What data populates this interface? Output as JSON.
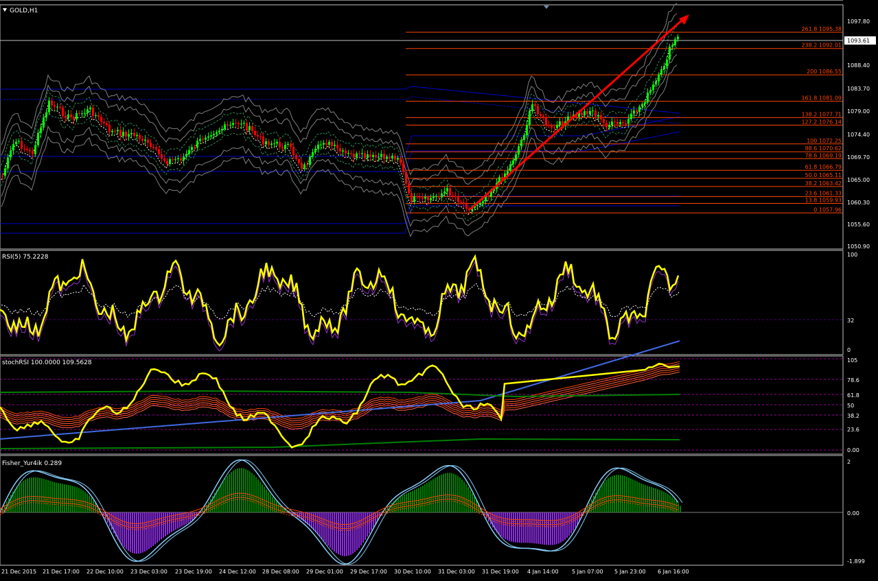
{
  "symbol_title": "GOLD,H1",
  "price_axis": {
    "ticks": [
      "1097.80",
      "1093.61",
      "1088.40",
      "1083.70",
      "1079.00",
      "1074.40",
      "1069.70",
      "1065.00",
      "1060.30",
      "1055.60",
      "1050.90"
    ],
    "current_price": "1093.61"
  },
  "fib_levels": [
    {
      "label": "261.8 1095.38",
      "price": 1095.38
    },
    {
      "label": "238.2 1092.01",
      "price": 1092.01
    },
    {
      "label": "200 1086.55",
      "price": 1086.55
    },
    {
      "label": "161.8 1081.09",
      "price": 1081.09
    },
    {
      "label": "138.2 1077.71",
      "price": 1077.71
    },
    {
      "label": "127.2 1076.14",
      "price": 1076.14
    },
    {
      "label": "100 1072.25",
      "price": 1072.25
    },
    {
      "label": "88.6 1070.62",
      "price": 1070.62
    },
    {
      "label": "78.6 1069.19",
      "price": 1069.19
    },
    {
      "label": "61.8 1066.79",
      "price": 1066.79
    },
    {
      "label": "50.0 1065.11",
      "price": 1065.11
    },
    {
      "label": "38.2 1063.42",
      "price": 1063.42
    },
    {
      "label": "23.6 1061.33",
      "price": 1061.33
    },
    {
      "label": "13.8 1059.93",
      "price": 1059.93
    },
    {
      "label": "0 1057.96",
      "price": 1057.96
    }
  ],
  "rsi_panel": {
    "title": "RSI(5) 75.2228",
    "ticks": [
      "100",
      "32",
      "0"
    ]
  },
  "stoch_panel": {
    "title": "stochRSI 100.0000 109.5628",
    "ticks": [
      "105",
      "78.6",
      "61.8",
      "50",
      "38.2",
      "23.6",
      "0.00"
    ]
  },
  "fisher_panel": {
    "title": "Fisher_Yur4ik 0.289",
    "ticks": [
      "2",
      "0.00",
      "-1.899"
    ]
  },
  "time_axis": [
    "21 Dec 2015",
    "21 Dec 17:00",
    "22 Dec 10:00",
    "23 Dec 03:00",
    "23 Dec 19:00",
    "24 Dec 12:00",
    "28 Dec 08:00",
    "29 Dec 01:00",
    "29 Dec 17:00",
    "30 Dec 10:00",
    "31 Dec 03:00",
    "31 Dec 19:00",
    "4 Jan 14:00",
    "5 Jan 07:00",
    "5 Jan 23:00",
    "6 Jan 16:00"
  ],
  "colors": {
    "background": "#000000",
    "bull": "#00ff00",
    "bear": "#ff0000",
    "fib": "#ff4500",
    "rsi": "#ffff00",
    "arrow": "#ff0000",
    "envelope": "#0000cd"
  }
}
